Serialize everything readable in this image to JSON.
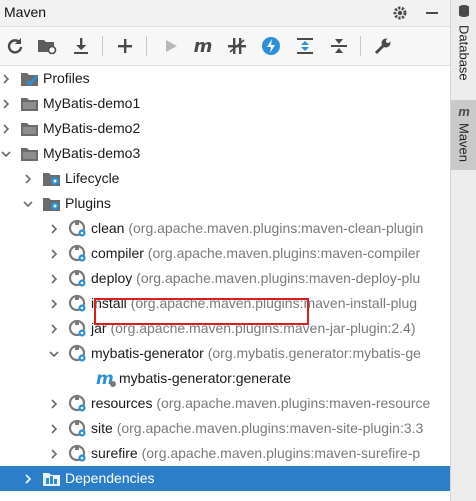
{
  "window": {
    "title": "Maven"
  },
  "toolbar": {
    "items": [
      {
        "icon": "refresh-icon"
      },
      {
        "icon": "folder-refresh-icon"
      },
      {
        "icon": "download-icon"
      },
      {
        "icon": "add-icon"
      },
      {
        "icon": "run-icon"
      },
      {
        "icon": "maven-m-icon",
        "glyph": "m"
      },
      {
        "icon": "toggle-offline-icon"
      },
      {
        "icon": "skip-tests-icon"
      },
      {
        "icon": "expand-all-icon"
      },
      {
        "icon": "collapse-all-icon"
      },
      {
        "icon": "settings-wrench-icon"
      }
    ]
  },
  "tree": {
    "rows": [
      {
        "label": "Profiles",
        "detail": "",
        "depth": 0,
        "expanded": false,
        "icon": "profiles-icon"
      },
      {
        "label": "MyBatis-demo1",
        "detail": "",
        "depth": 0,
        "expanded": false,
        "icon": "maven-project-icon"
      },
      {
        "label": "MyBatis-demo2",
        "detail": "",
        "depth": 0,
        "expanded": false,
        "icon": "maven-project-icon"
      },
      {
        "label": "MyBatis-demo3",
        "detail": "",
        "depth": 0,
        "expanded": true,
        "icon": "maven-project-icon"
      },
      {
        "label": "Lifecycle",
        "detail": "",
        "depth": 1,
        "expanded": false,
        "icon": "folder-gear-icon"
      },
      {
        "label": "Plugins",
        "detail": "",
        "depth": 1,
        "expanded": true,
        "icon": "folder-gear-icon"
      },
      {
        "label": "clean",
        "detail": "(org.apache.maven.plugins:maven-clean-plugin",
        "depth": 2,
        "expanded": false,
        "icon": "plugin-icon"
      },
      {
        "label": "compiler",
        "detail": "(org.apache.maven.plugins:maven-compiler",
        "depth": 2,
        "expanded": false,
        "icon": "plugin-icon"
      },
      {
        "label": "deploy",
        "detail": "(org.apache.maven.plugins:maven-deploy-plu",
        "depth": 2,
        "expanded": false,
        "icon": "plugin-icon"
      },
      {
        "label": "install",
        "detail": "(org.apache.maven.plugins:maven-install-plug",
        "depth": 2,
        "expanded": false,
        "icon": "plugin-icon"
      },
      {
        "label": "jar",
        "detail": "(org.apache.maven.plugins:maven-jar-plugin:2.4)",
        "depth": 2,
        "expanded": false,
        "icon": "plugin-icon"
      },
      {
        "label": "mybatis-generator",
        "detail": "(org.mybatis.generator:mybatis-ge",
        "depth": 2,
        "expanded": true,
        "icon": "plugin-icon"
      },
      {
        "label": "mybatis-generator:generate",
        "detail": "",
        "depth": 3,
        "expanded": null,
        "icon": "goal-icon"
      },
      {
        "label": "resources",
        "detail": "(org.apache.maven.plugins:maven-resource",
        "depth": 2,
        "expanded": false,
        "icon": "plugin-icon"
      },
      {
        "label": "site",
        "detail": "(org.apache.maven.plugins:maven-site-plugin:3.3",
        "depth": 2,
        "expanded": false,
        "icon": "plugin-icon"
      },
      {
        "label": "surefire",
        "detail": "(org.apache.maven.plugins:maven-surefire-p",
        "depth": 2,
        "expanded": false,
        "icon": "plugin-icon"
      },
      {
        "label": "Dependencies",
        "detail": "",
        "depth": 1,
        "expanded": false,
        "icon": "dependencies-icon",
        "selected": true
      }
    ]
  },
  "sidebar": {
    "tabs": [
      {
        "label": "Database",
        "icon": "database-icon",
        "active": false
      },
      {
        "label": "Maven",
        "icon": "maven-m-icon",
        "active": true
      }
    ]
  },
  "colors": {
    "selection": "#2d7ec9",
    "accent_blue": "#2d8fd5",
    "highlight_border": "#d81e1e",
    "icon_gray": "#4a4a4a"
  }
}
